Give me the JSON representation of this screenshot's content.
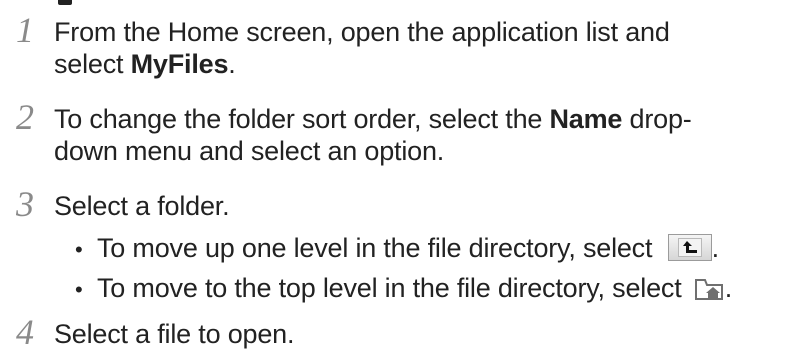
{
  "steps": [
    {
      "number": "1",
      "line1": "From the Home screen, open the application list and",
      "line2_prefix": "select ",
      "line2_bold": "MyFiles",
      "line2_suffix": "."
    },
    {
      "number": "2",
      "line1_prefix": "To change the folder sort order, select the ",
      "line1_bold": "Name",
      "line1_suffix": " drop-",
      "line2": "down menu and select an option."
    },
    {
      "number": "3",
      "line1": "Select a folder.",
      "bullets": [
        {
          "marker": "•",
          "text": "To move up one level in the file directory, select ",
          "icon": "folder-up-icon",
          "suffix": "."
        },
        {
          "marker": "•",
          "text": "To move to the top level in the file directory, select ",
          "icon": "folder-home-icon",
          "suffix": "."
        }
      ]
    },
    {
      "number": "4",
      "line1": "Select a file to open."
    }
  ],
  "colors": {
    "text": "#222222",
    "step_number": "#8a8a8a",
    "icon_arrow": "#111111"
  }
}
